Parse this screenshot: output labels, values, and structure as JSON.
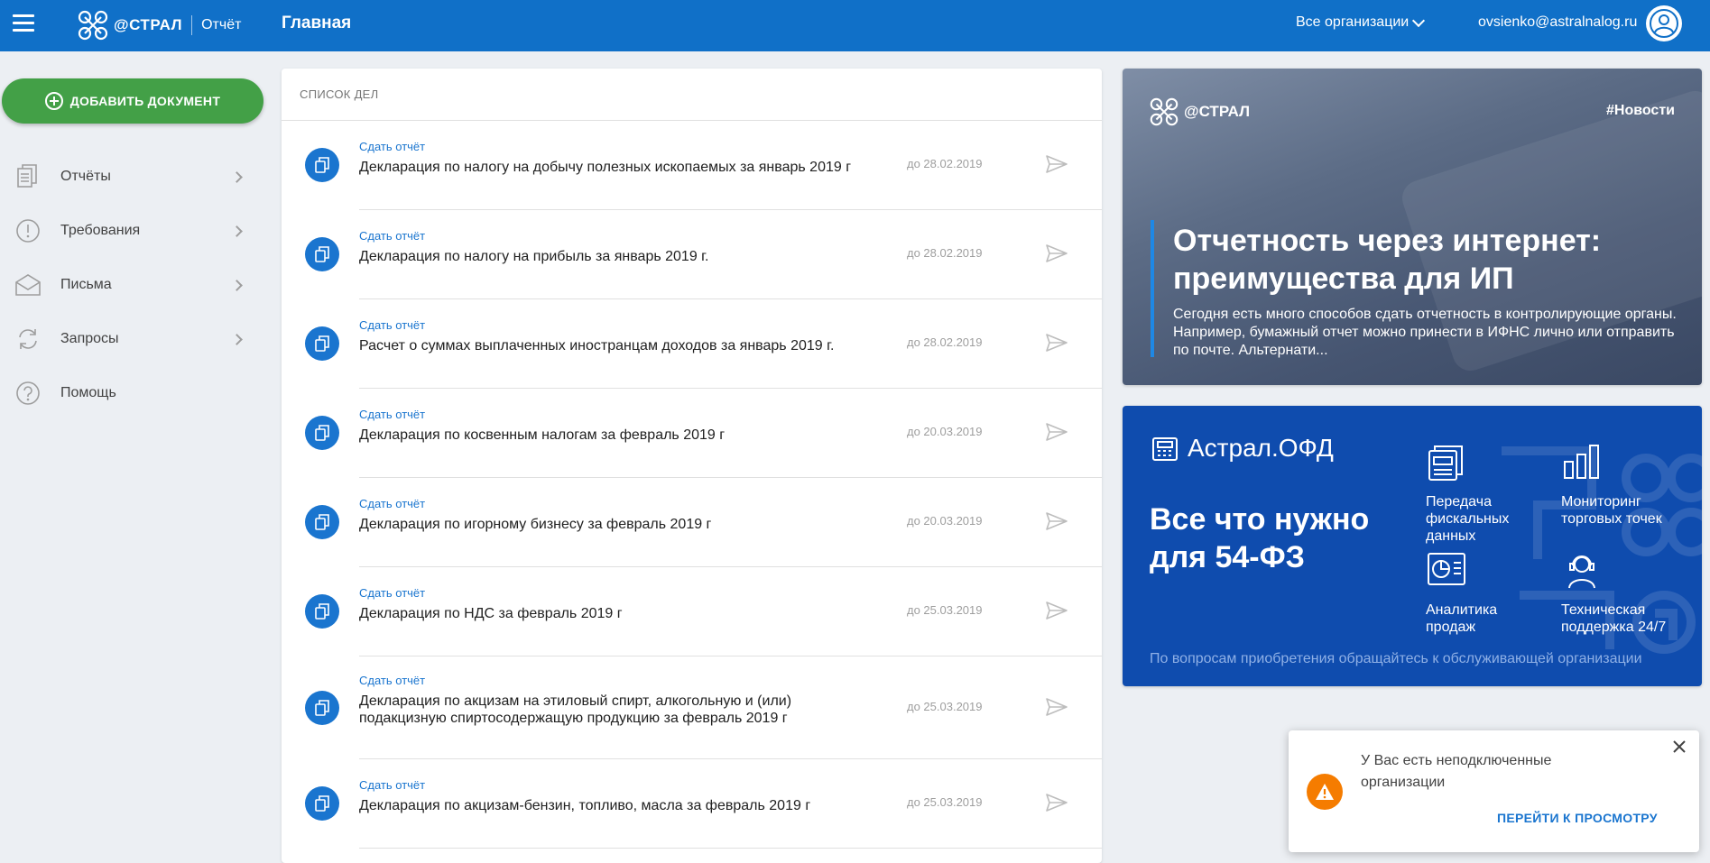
{
  "header": {
    "brand": "@СТРАЛ",
    "product": "Отчёт",
    "title": "Главная",
    "org_select": "Все организации",
    "user_email": "ovsienko@astralnalog.ru"
  },
  "sidebar": {
    "add_button": "ДОБАВИТЬ ДОКУМЕНТ",
    "items": [
      {
        "label": "Отчёты",
        "icon": "reports-icon"
      },
      {
        "label": "Требования",
        "icon": "alert-circle-icon"
      },
      {
        "label": "Письма",
        "icon": "envelope-icon"
      },
      {
        "label": "Запросы",
        "icon": "sync-icon"
      },
      {
        "label": "Помощь",
        "icon": "help-icon"
      }
    ]
  },
  "tasks": {
    "header": "СПИСОК ДЕЛ",
    "items": [
      {
        "type": "Сдать отчёт",
        "title": "Декларация по налогу на добычу полезных ископаемых за январь 2019 г",
        "due": "до 28.02.2019"
      },
      {
        "type": "Сдать отчёт",
        "title": "Декларация по налогу на прибыль за январь 2019 г.",
        "due": "до 28.02.2019"
      },
      {
        "type": "Сдать отчёт",
        "title": "Расчет о суммах выплаченных иностранцам доходов за январь 2019 г.",
        "due": "до 28.02.2019"
      },
      {
        "type": "Сдать отчёт",
        "title": "Декларация по косвенным налогам за февраль 2019 г",
        "due": "до 20.03.2019"
      },
      {
        "type": "Сдать отчёт",
        "title": "Декларация по игорному бизнесу за февраль 2019 г",
        "due": "до 20.03.2019"
      },
      {
        "type": "Сдать отчёт",
        "title": "Декларация по НДС за февраль 2019 г",
        "due": "до 25.03.2019"
      },
      {
        "type": "Сдать отчёт",
        "title_line1": "Декларация по акцизам на этиловый спирт, алкогольную и (или)",
        "title_line2": "подакцизную спиртосодержащую продукцию за февраль 2019 г",
        "due": "до 25.03.2019"
      },
      {
        "type": "Сдать отчёт",
        "title": "Декларация по акцизам-бензин, топливо, масла за февраль 2019 г",
        "due": "до 25.03.2019"
      }
    ]
  },
  "news": {
    "brand": "@СТРАЛ",
    "tag": "#Новости",
    "title": "Отчетность через интернет: преимущества для ИП",
    "text": "Сегодня есть много способов сдать отчетность в контролирующие органы. Например, бумажный отчет можно принести в ИФНС лично или отправить по почте. Альтернати..."
  },
  "ofd": {
    "brand": "Астрал.ОФД",
    "headline": "Все что нужно для 54-ФЗ",
    "features": [
      {
        "label_1": "Передача",
        "label_2": "фискальных",
        "label_3": "данных",
        "icon": "receipts-icon"
      },
      {
        "label_1": "Мониторинг",
        "label_2": "торговых точек",
        "icon": "bar-chart-icon"
      },
      {
        "label_1": "Аналитика",
        "label_2": "продаж",
        "icon": "analytics-icon"
      },
      {
        "label_1": "Техническая",
        "label_2": "поддержка 24/7",
        "icon": "support-icon"
      }
    ],
    "footer": "По вопросам приобретения обращайтесь к обслуживающей организации"
  },
  "toast": {
    "message": "У Вас есть неподключенные организации",
    "action": "ПЕРЕЙТИ К ПРОСМОТРУ"
  },
  "colors": {
    "header": "#1070c8",
    "accent_blue": "#1a75cf",
    "add_button": "#43a047",
    "ofd_bg": "#0f4cae",
    "warning": "#f57c00"
  }
}
